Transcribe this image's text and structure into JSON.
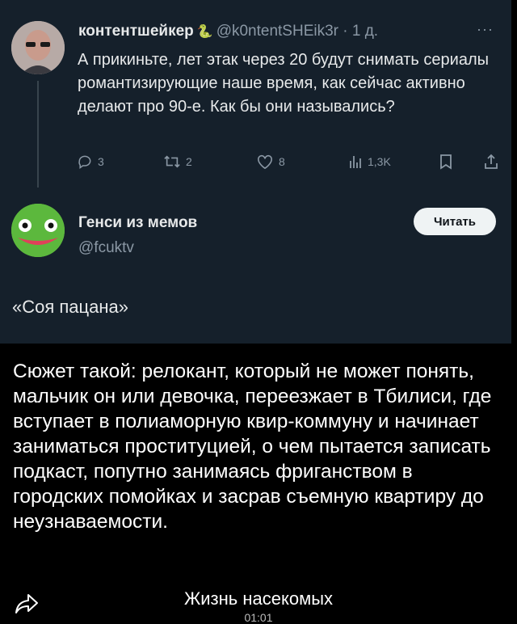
{
  "tweet1": {
    "author_name": "контентшейкер",
    "author_badge": "🐍",
    "handle": "@k0ntentSHEik3r",
    "separator": "·",
    "time": "1 д.",
    "more": "···",
    "text": "А прикиньте, лет этак через 20 будут снимать сериалы романтизирующие наше время, как сейчас активно делают про 90-е. Как бы они назывались?",
    "actions": {
      "replies": "3",
      "retweets": "2",
      "likes": "8",
      "views": "1,3K"
    }
  },
  "tweet2": {
    "author_name": "Генси из мемов",
    "handle": "@fcuktv",
    "follow_label": "Читать",
    "text": "«Соя пацана»"
  },
  "caption": "Сюжет такой: релокант, который не может понять, мальчик он или девочка, переезжает в Тбилиси, где вступает в полиаморную квир-коммуну и начинает заниматься проституцией, о чем пытается записать подкаст, попутно занимаясь фриганством в городских помойках и засрав съемную квартиру до неузнаваемости.",
  "sound": {
    "title": "Жизнь насекомых",
    "time": "01:01"
  }
}
